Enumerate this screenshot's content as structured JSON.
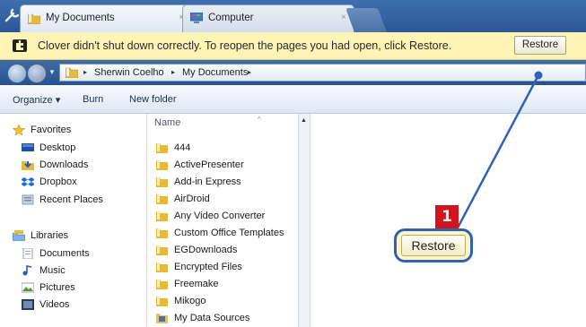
{
  "browser": {
    "tabs": [
      {
        "label": "My Documents",
        "close_glyph": "×",
        "icon": "folder-icon"
      },
      {
        "label": "Computer",
        "close_glyph": "×",
        "icon": "computer-icon"
      }
    ]
  },
  "infobar": {
    "message": "Clover didn't shut down correctly. To reopen the pages you had open, click Restore.",
    "restore_label": "Restore",
    "icon": "puzzle-icon",
    "bg_color": "#fdf4b6"
  },
  "address": {
    "crumbs": [
      "Sherwin Coelho",
      "My Documents"
    ],
    "separator": "▸"
  },
  "toolbar": {
    "organize_label": "Organize ▾",
    "burn_label": "Burn",
    "new_folder_label": "New folder"
  },
  "nav": {
    "favorites_label": "Favorites",
    "favorites": [
      "Desktop",
      "Downloads",
      "Dropbox",
      "Recent Places"
    ],
    "libraries_label": "Libraries",
    "libraries": [
      "Documents",
      "Music",
      "Pictures",
      "Videos"
    ]
  },
  "files": {
    "column_name": "Name",
    "sort_glyph": "^",
    "items": [
      "444",
      "ActivePresenter",
      "Add-in Express",
      "AirDroid",
      "Any Video Converter",
      "Custom Office Templates",
      "EGDownloads",
      "Encrypted Files",
      "Freemake",
      "Mikogo",
      "My Data Sources"
    ]
  },
  "callout": {
    "step_number": "1",
    "restore_label": "Restore",
    "accent_color": "#2e63b4",
    "badge_color": "#d0161c"
  },
  "scrollbar": {
    "up_glyph": "▲"
  }
}
